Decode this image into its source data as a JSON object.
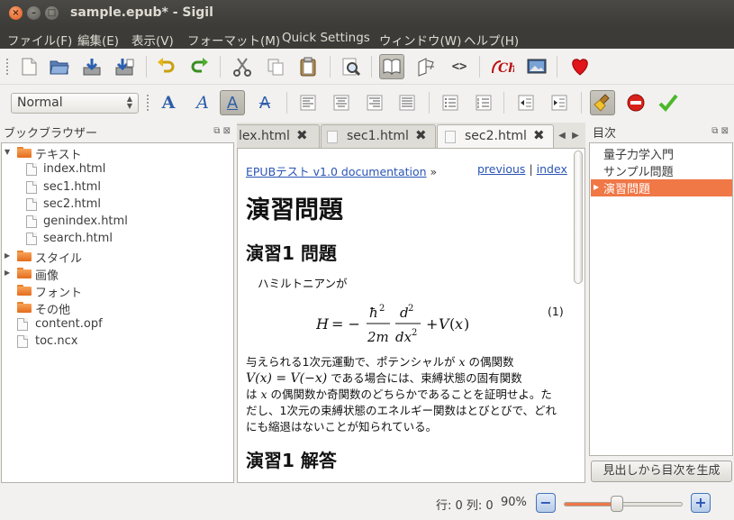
{
  "window": {
    "title": "sample.epub* - Sigil"
  },
  "menu": [
    "ファイル(F)",
    "編集(E)",
    "表示(V)",
    "フォーマット(M)",
    "Quick Settings",
    "ウィンドウ(W)",
    "ヘルプ(H)"
  ],
  "toolbar": {
    "row1_icons": [
      "new-file-icon",
      "open-folder-icon",
      "save-icon",
      "save-as-icon",
      "undo-icon",
      "redo-icon",
      "cut-icon",
      "copy-icon",
      "paste-icon",
      "find-icon",
      "book-view-icon",
      "split-view-icon",
      "code-view-icon",
      "spellcheck-icon",
      "image-icon",
      "heart-icon"
    ],
    "style_select": "Normal",
    "row2_icons": [
      "bold-icon",
      "italic-icon",
      "underline-icon",
      "strikethrough-icon",
      "align-left-icon",
      "align-center-icon",
      "align-right-icon",
      "justify-icon",
      "bullet-list-icon",
      "numbered-list-icon",
      "outdent-icon",
      "indent-icon",
      "clean-broom-icon",
      "stop-icon",
      "check-icon"
    ],
    "colors": {
      "accent": "#f07746",
      "titlebar": "#3c3b37"
    }
  },
  "book_browser": {
    "title": "ブックブラウザー",
    "items": [
      {
        "label": "テキスト",
        "type": "folder",
        "expanded": true
      },
      {
        "label": "index.html",
        "type": "file"
      },
      {
        "label": "sec1.html",
        "type": "file"
      },
      {
        "label": "sec2.html",
        "type": "file"
      },
      {
        "label": "genindex.html",
        "type": "file"
      },
      {
        "label": "search.html",
        "type": "file"
      },
      {
        "label": "スタイル",
        "type": "folder",
        "expanded": false
      },
      {
        "label": "画像",
        "type": "folder",
        "expanded": false
      },
      {
        "label": "フォント",
        "type": "folder"
      },
      {
        "label": "その他",
        "type": "folder"
      },
      {
        "label": "content.opf",
        "type": "file"
      },
      {
        "label": "toc.ncx",
        "type": "file"
      }
    ]
  },
  "tabs": [
    {
      "label": "lex.html"
    },
    {
      "label": "sec1.html"
    },
    {
      "label": "sec2.html",
      "active": true
    }
  ],
  "document": {
    "nav_left": "EPUBテスト v1.0 documentation",
    "nav_sep": "»",
    "nav_previous": "previous",
    "nav_divider": "|",
    "nav_index": "index",
    "heading1": "演習問題",
    "heading2a": "演習1 問題",
    "intro": "ハミルトニアンが",
    "equation_number": "(1)",
    "para_line1": "与えられる1次元運動で、ポテンシャルが",
    "para_line1b": "の偶関数",
    "para_line2": "である場合には、束縛状態の固有関数",
    "para_line3": "の偶関数か奇関数のどちらかであることを証明せよ。た",
    "para_line4": "だし、1次元の束縛状態のエネルギー関数はとびとびで、どれ",
    "para_line5": "にも縮退はないことが知られている。",
    "para_line3a": "は",
    "heading2b": "演習1 解答"
  },
  "toc": {
    "title": "目次",
    "items": [
      {
        "label": "量子力学入門"
      },
      {
        "label": "サンプル問題"
      },
      {
        "label": "演習問題",
        "selected": true
      }
    ],
    "generate_button": "見出しから目次を生成"
  },
  "status": {
    "position": "行: 0 列: 0",
    "zoom": "90%",
    "zoom_level": 0.45
  }
}
